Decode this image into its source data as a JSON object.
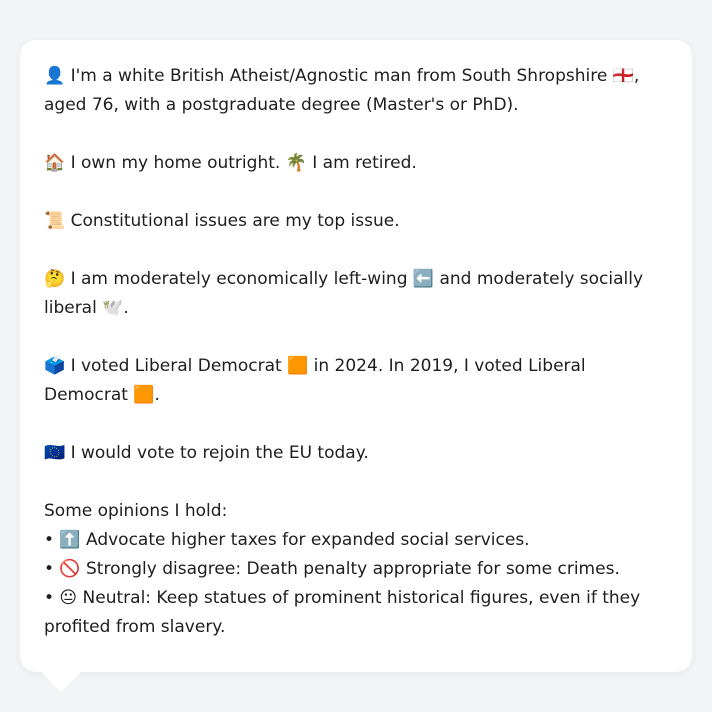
{
  "profile": {
    "intro": "👤 I'm a white British Atheist/Agnostic man from South Shropshire 🏴󠁧󠁢󠁥󠁮󠁧󠁿, aged 76, with a postgraduate degree (Master's or PhD).",
    "home": "🏠 I own my home outright. 🌴 I am retired.",
    "top_issue": "📜 Constitutional issues are my top issue.",
    "ideology": "🤔 I am moderately economically left-wing ⬅️ and moderately socially liberal 🕊️.",
    "votes": "🗳️ I voted Liberal Democrat 🟧 in 2024. In 2019, I voted Liberal Democrat 🟧.",
    "eu": "🇪🇺 I would vote to rejoin the EU today.",
    "opinions_heading": "Some opinions I hold:",
    "opinions": [
      "• ⬆️ Advocate higher taxes for expanded social services.",
      "• 🚫 Strongly disagree: Death penalty appropriate for some crimes.",
      "• 😐 Neutral: Keep statues of prominent historical figures, even if they profited from slavery."
    ]
  }
}
